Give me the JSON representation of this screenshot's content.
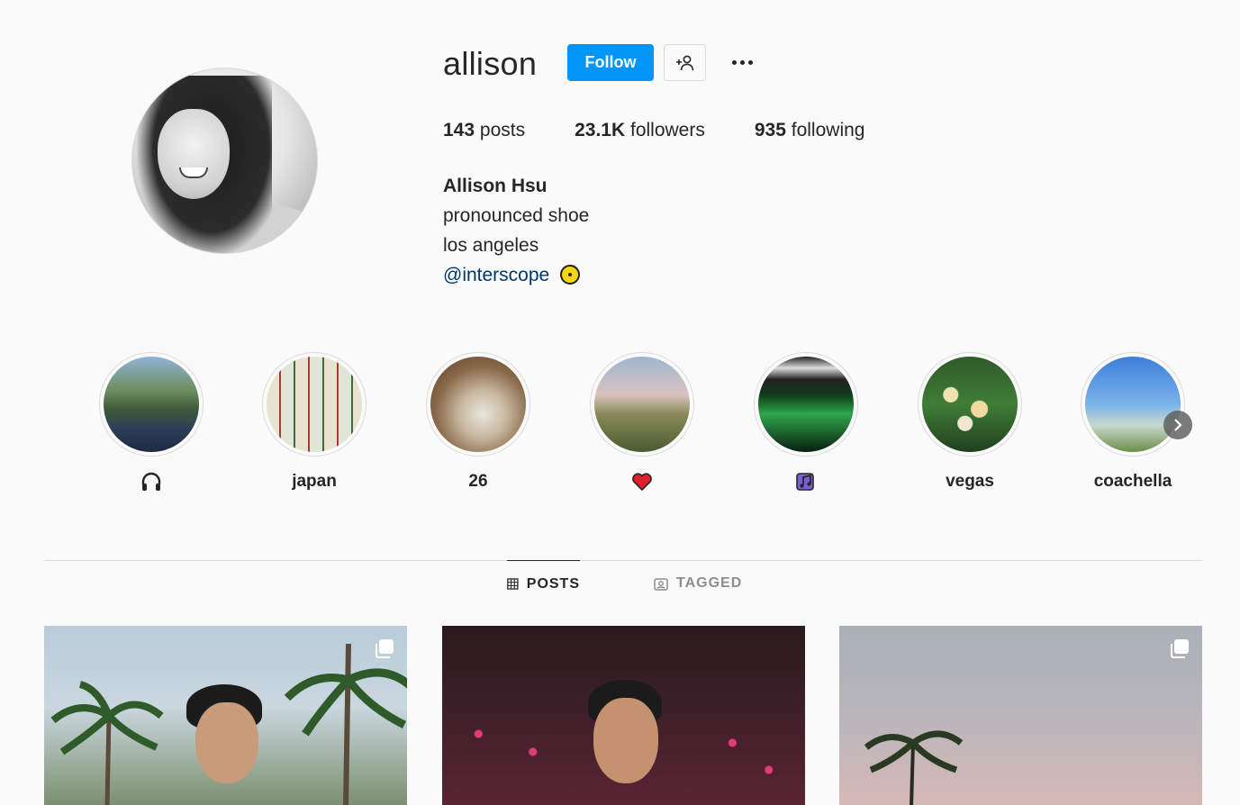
{
  "profile": {
    "username": "allison",
    "follow_label": "Follow",
    "posts_count": "143",
    "posts_label": "posts",
    "followers_count": "23.1K",
    "followers_label": "followers",
    "following_count": "935",
    "following_label": "following",
    "full_name": "Allison Hsu",
    "bio_lines": [
      "pronounced shoe",
      "los angeles"
    ],
    "link_handle": "@interscope",
    "link_emoji": "disc-icon"
  },
  "highlights": [
    {
      "label": "",
      "icon": "headphones-icon"
    },
    {
      "label": "japan"
    },
    {
      "label": "26"
    },
    {
      "label": "",
      "icon": "heart-icon"
    },
    {
      "label": "",
      "icon": "music-notes-icon"
    },
    {
      "label": "vegas"
    },
    {
      "label": "coachella"
    }
  ],
  "tabs": [
    {
      "label": "POSTS",
      "icon": "grid-icon",
      "active": true
    },
    {
      "label": "TAGGED",
      "icon": "tagged-icon",
      "active": false
    }
  ],
  "posts": [
    {
      "multi": true,
      "icon": "carousel-icon"
    },
    {
      "multi": false
    },
    {
      "multi": true,
      "icon": "carousel-icon"
    }
  ],
  "colors": {
    "accent": "#0095f6",
    "text": "#262626",
    "muted": "#8e8e8e",
    "border": "#dbdbdb",
    "background": "#fafafa",
    "link": "#00376b",
    "heart": "#e0202e"
  }
}
